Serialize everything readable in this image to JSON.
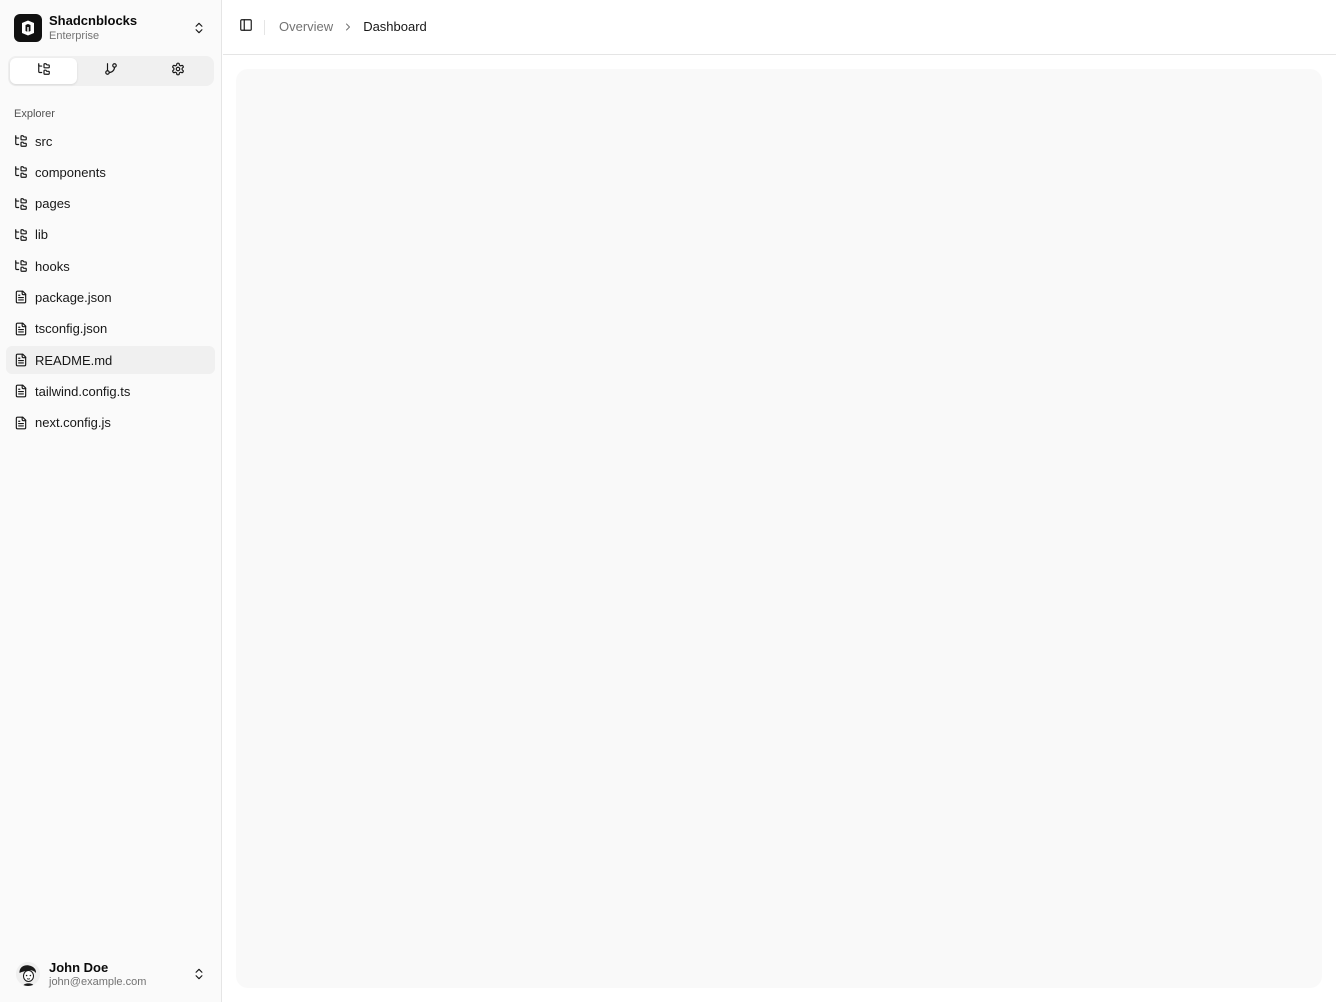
{
  "team": {
    "name": "Shadcnblocks",
    "plan": "Enterprise"
  },
  "tabs": [
    {
      "icon": "folder-tree-icon",
      "active": true
    },
    {
      "icon": "git-branch-icon",
      "active": false
    },
    {
      "icon": "settings-icon",
      "active": false
    }
  ],
  "explorer": {
    "label": "Explorer",
    "items": [
      {
        "label": "src",
        "icon": "folder-tree-icon"
      },
      {
        "label": "components",
        "icon": "folder-tree-icon"
      },
      {
        "label": "pages",
        "icon": "folder-tree-icon"
      },
      {
        "label": "lib",
        "icon": "folder-tree-icon"
      },
      {
        "label": "hooks",
        "icon": "folder-tree-icon"
      },
      {
        "label": "package.json",
        "icon": "file-text-icon"
      },
      {
        "label": "tsconfig.json",
        "icon": "file-text-icon"
      },
      {
        "label": "README.md",
        "icon": "file-text-icon",
        "selected": true
      },
      {
        "label": "tailwind.config.ts",
        "icon": "file-text-icon"
      },
      {
        "label": "next.config.js",
        "icon": "file-text-icon"
      }
    ]
  },
  "user": {
    "name": "John Doe",
    "email": "john@example.com"
  },
  "breadcrumb": {
    "parent": "Overview",
    "current": "Dashboard"
  },
  "colors": {
    "sidebar_bg": "#fafafa",
    "content_bg": "#f9f9f9",
    "border": "#e5e5e5",
    "muted_text": "#737373"
  }
}
